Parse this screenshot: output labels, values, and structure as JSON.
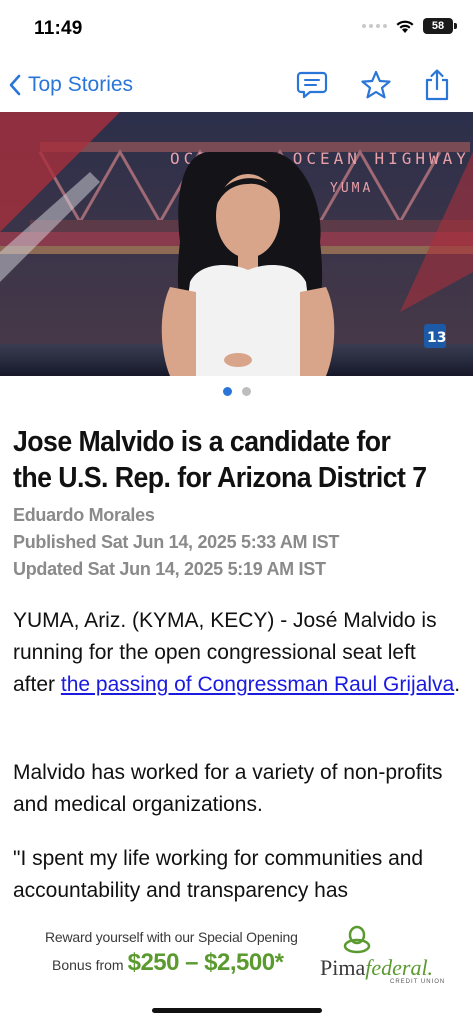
{
  "status_bar": {
    "time": "11:49",
    "battery": "58"
  },
  "nav": {
    "back_label": "Top Stories",
    "icons": [
      "comment-icon",
      "star-icon",
      "share-icon"
    ]
  },
  "hero": {
    "sign_text": "OCEAN TO OCEAN HIGHWAY",
    "sign_sub": "YUMA",
    "channel_badge": "13"
  },
  "carousel": {
    "count": 2,
    "active_index": 0
  },
  "article": {
    "headline": "Jose Malvido is a candidate for the U.S. Rep. for Arizona District 7",
    "author": "Eduardo Morales",
    "published": "Published Sat Jun 14, 2025 5:33 AM IST",
    "updated": "Updated Sat Jun 14, 2025 5:19 AM IST",
    "p1_prefix": "YUMA, Ariz. (KYMA, KECY) - José Malvido is running for the open congressional seat left after ",
    "p1_link": "the passing of Congressman Raul Grijalva",
    "p1_suffix": ".",
    "p2": "Malvido has worked for a variety of non-profits and medical organizations.",
    "p3": "\"I spent my life working for communities and accountability and transparency has"
  },
  "ad": {
    "line1": "Reward yourself with our Special Opening",
    "bonus_from": "Bonus from",
    "amount": "$250 – $2,500*",
    "brand_pima": "Pima",
    "brand_federal": "federal.",
    "brand_sub": "CREDIT UNION"
  },
  "colors": {
    "accent": "#2a76d8",
    "link": "#1a1ae0",
    "meta_gray": "#8a8a8a",
    "ad_green": "#5a9a2e"
  }
}
